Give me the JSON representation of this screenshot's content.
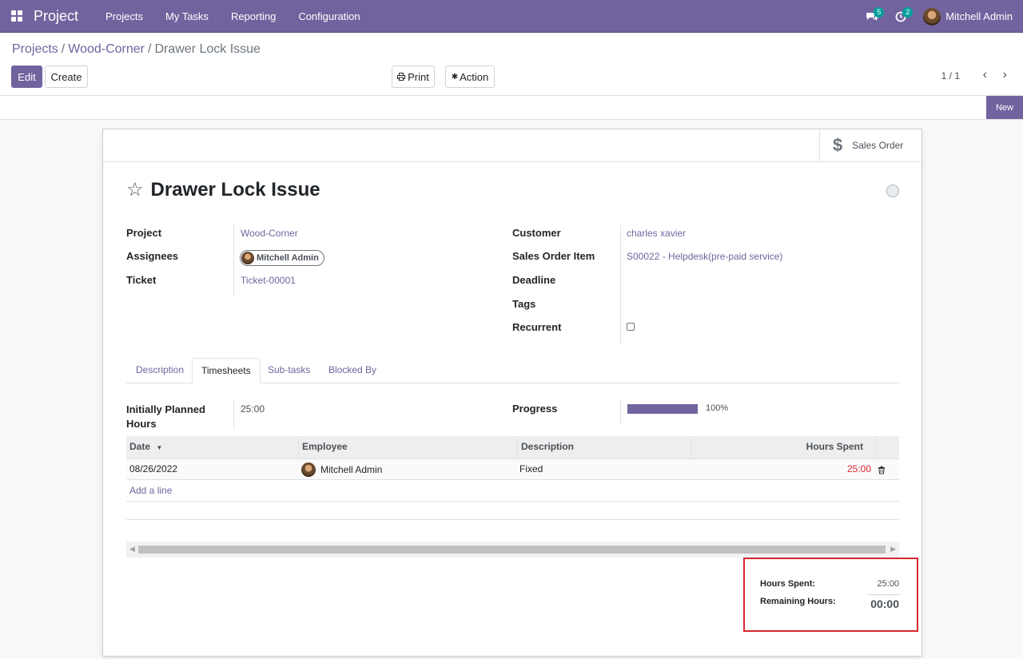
{
  "app": {
    "title": "Project"
  },
  "menu": [
    "Projects",
    "My Tasks",
    "Reporting",
    "Configuration"
  ],
  "systray": {
    "messages_count": "5",
    "activities_count": "2",
    "user_name": "Mitchell Admin"
  },
  "breadcrumb": {
    "root": "Projects",
    "project": "Wood-Corner",
    "current": "Drawer Lock Issue"
  },
  "toolbar": {
    "edit_label": "Edit",
    "create_label": "Create",
    "print_label": "Print",
    "action_label": "Action"
  },
  "pager": {
    "value": "1 / 1"
  },
  "stage": {
    "current": "New"
  },
  "smart_button": {
    "label": "Sales Order"
  },
  "task": {
    "title": "Drawer Lock Issue",
    "left_fields": [
      {
        "label": "Project",
        "value": "Wood-Corner"
      },
      {
        "label": "Assignees",
        "value": "Mitchell Admin"
      },
      {
        "label": "Ticket",
        "value": "Ticket-00001"
      }
    ],
    "right_fields": [
      {
        "label": "Customer",
        "value": "charles xavier"
      },
      {
        "label": "Sales Order Item",
        "value": "S00022 - Helpdesk(pre-paid service)"
      },
      {
        "label": "Deadline",
        "value": ""
      },
      {
        "label": "Tags",
        "value": ""
      },
      {
        "label": "Recurrent",
        "value": ""
      }
    ]
  },
  "tabs": [
    "Description",
    "Timesheets",
    "Sub-tasks",
    "Blocked By"
  ],
  "timesheet": {
    "planned_label_line1": "Initially Planned",
    "planned_label_line2": "Hours",
    "planned_value": "25:00",
    "progress_label": "Progress",
    "progress_percent": 100,
    "progress_text": "100%",
    "columns": [
      "Date",
      "Employee",
      "Description",
      "Hours Spent"
    ],
    "rows": [
      {
        "date": "08/26/2022",
        "employee": "Mitchell Admin",
        "description": "Fixed",
        "hours": "25:00"
      }
    ],
    "add_line": "Add a line"
  },
  "totals": {
    "hours_spent_label": "Hours Spent:",
    "hours_spent_value": "25:00",
    "remaining_label": "Remaining Hours:",
    "remaining_value": "00:00"
  },
  "colors": {
    "brand": "#71639e",
    "overtime": "#d9262e",
    "highlight_border": "#d9262e"
  }
}
